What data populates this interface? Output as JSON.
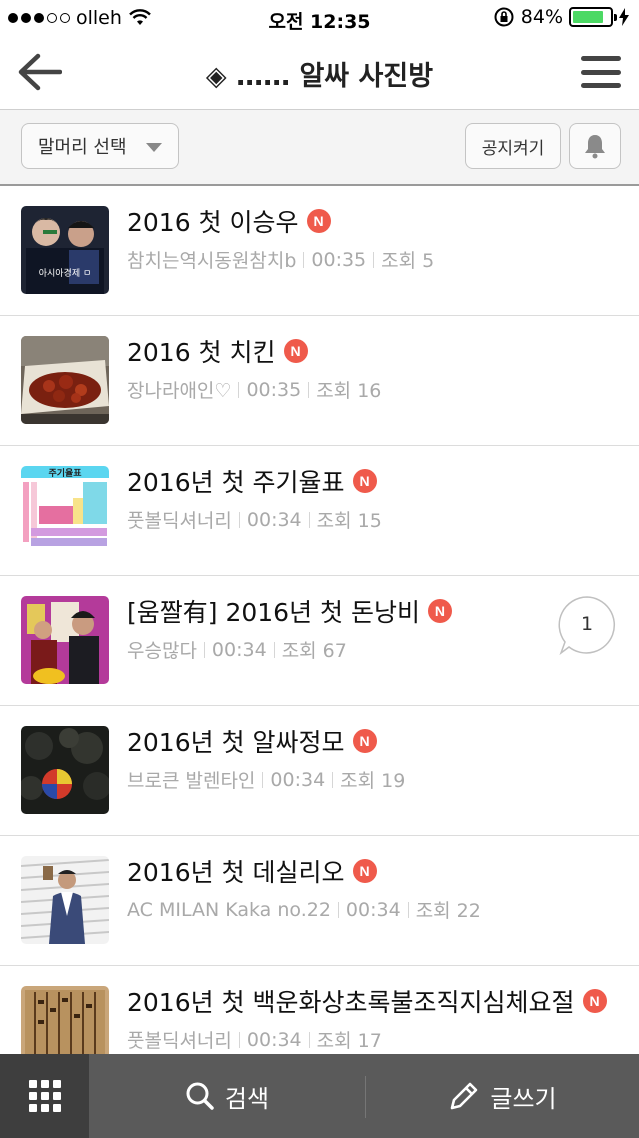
{
  "status_bar": {
    "carrier": "olleh",
    "time": "오전 12:35",
    "battery": "84%",
    "battery_level": 0.84
  },
  "nav": {
    "title": "◈ …… 알싸 사진방"
  },
  "filter": {
    "category_label": "말머리 선택",
    "notice_label": "공지켜기"
  },
  "posts": [
    {
      "title": "2016 첫 이승우",
      "author": "참치는역시동원참치b",
      "time": "00:35",
      "views": "조회 5",
      "thumb_text": "아시아경제 ㅁ"
    },
    {
      "title": "2016 첫 치킨",
      "author": "장나라애인♡",
      "time": "00:35",
      "views": "조회 16"
    },
    {
      "title": "2016년 첫 주기율표",
      "author": "풋볼딕셔너리",
      "time": "00:34",
      "views": "조회 15",
      "thumb_text": "주기율표"
    },
    {
      "title": "[움짤有] 2016년 첫 돈낭비",
      "author": "우승많다",
      "time": "00:34",
      "views": "조회 67",
      "comments": "1"
    },
    {
      "title": "2016년 첫 알싸정모",
      "author": "브로큰 발렌타인",
      "time": "00:34",
      "views": "조회 19"
    },
    {
      "title": "2016년 첫 데실리오",
      "author": "AC MILAN Kaka no.22",
      "time": "00:34",
      "views": "조회 22"
    },
    {
      "title": "2016년 첫 백운화상초록불조직지심체요절",
      "author": "풋볼딕셔너리",
      "time": "00:34",
      "views": "조회 17"
    }
  ],
  "new_badge": "N",
  "bottom_bar": {
    "search_label": "검색",
    "write_label": "글쓰기"
  },
  "colors": {
    "new_badge": "#ef5a4b",
    "bottom_bar": "#5a5a5a",
    "battery": "#4cd964"
  }
}
